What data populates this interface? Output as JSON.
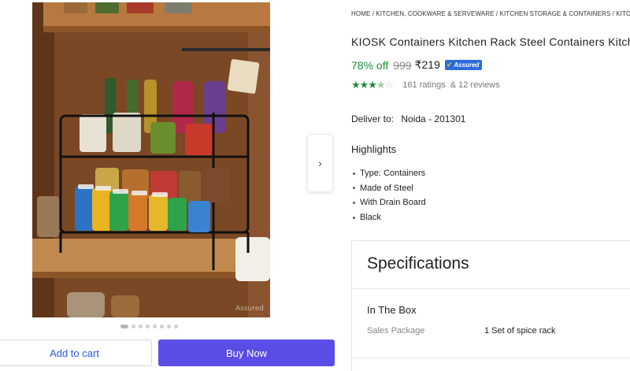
{
  "gallery": {
    "image_alt": "Two-tier black steel spice rack in a wooden cabinet",
    "watermark": "Assured",
    "next_icon": "chevron-right-icon",
    "dot_count": 8,
    "active_dot": 0
  },
  "actions": {
    "add_to_cart": "Add to cart",
    "buy_now": "Buy Now",
    "buy_now_color": "#5a4de6"
  },
  "product": {
    "breadcrumb": "HOME / KITCHEN, COOKWARE & SERVEWARE / KITCHEN STORAGE & CONTAINERS / KITC",
    "title": "KIOSK Containers Kitchen Rack Steel Containers Kitchen",
    "discount": "78% off",
    "mrp": "999",
    "price": "₹219",
    "assured_label": "Assured",
    "rating_stars": 3.5,
    "ratings_text": "161 ratings",
    "reviews_text": "& 12 reviews",
    "deliver_label": "Deliver to:",
    "deliver_location": "Noida - 201301"
  },
  "highlights": {
    "title": "Highlights",
    "items": [
      "Type: Containers",
      "Made of Steel",
      "With Drain Board",
      "Black"
    ]
  },
  "specifications": {
    "title": "Specifications",
    "section": "In The Box",
    "rows": [
      {
        "key": "Sales Package",
        "value": "1 Set of spice rack"
      }
    ]
  },
  "colors": {
    "discount_green": "#1a8c3a",
    "assured_blue": "#2c6bdc",
    "star_green": "#1f8a3d"
  }
}
